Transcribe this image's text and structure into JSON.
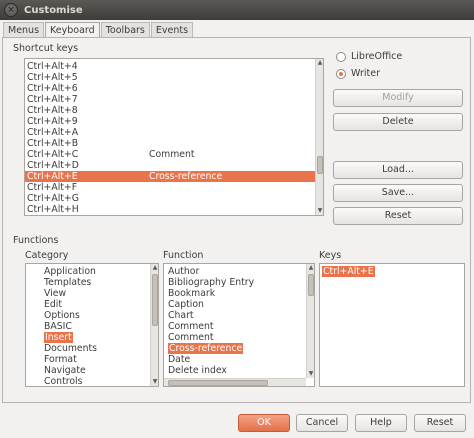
{
  "window": {
    "title": "Customise"
  },
  "tabs": [
    "Menus",
    "Keyboard",
    "Toolbars",
    "Events"
  ],
  "shortcut_section": {
    "label": "Shortcut keys",
    "rows": [
      {
        "key": "Ctrl+Alt+4",
        "func": ""
      },
      {
        "key": "Ctrl+Alt+5",
        "func": ""
      },
      {
        "key": "Ctrl+Alt+6",
        "func": ""
      },
      {
        "key": "Ctrl+Alt+7",
        "func": ""
      },
      {
        "key": "Ctrl+Alt+8",
        "func": ""
      },
      {
        "key": "Ctrl+Alt+9",
        "func": ""
      },
      {
        "key": "Ctrl+Alt+A",
        "func": ""
      },
      {
        "key": "Ctrl+Alt+B",
        "func": ""
      },
      {
        "key": "Ctrl+Alt+C",
        "func": "Comment"
      },
      {
        "key": "Ctrl+Alt+D",
        "func": ""
      },
      {
        "key": "Ctrl+Alt+E",
        "func": "Cross-reference",
        "selected": true
      },
      {
        "key": "Ctrl+Alt+F",
        "func": ""
      },
      {
        "key": "Ctrl+Alt+G",
        "func": ""
      },
      {
        "key": "Ctrl+Alt+H",
        "func": ""
      }
    ]
  },
  "scope": {
    "libreoffice": "LibreOffice",
    "writer": "Writer",
    "selected": "Writer"
  },
  "side_buttons": {
    "modify": "Modify",
    "delete": "Delete",
    "load": "Load...",
    "save": "Save...",
    "reset": "Reset"
  },
  "functions": {
    "label": "Functions",
    "category_label": "Category",
    "function_label": "Function",
    "keys_label": "Keys",
    "categories": [
      "Application",
      "Templates",
      "View",
      "Edit",
      "Options",
      "BASIC",
      "Insert",
      "Documents",
      "Format",
      "Navigate",
      "Controls"
    ],
    "selected_category": "Insert",
    "functions": [
      "Author",
      "Bibliography Entry",
      "Bookmark",
      "Caption",
      "Chart",
      "Comment",
      "Comment",
      "Cross-reference",
      "Date",
      "Delete index"
    ],
    "selected_function": "Cross-reference",
    "keys": [
      "Ctrl+Alt+E"
    ]
  },
  "bottom_buttons": {
    "ok": "OK",
    "cancel": "Cancel",
    "help": "Help",
    "reset": "Reset"
  },
  "colors": {
    "accent": "#e9734a",
    "titlebar": "#3d3c38",
    "background": "#f2f1f0"
  }
}
